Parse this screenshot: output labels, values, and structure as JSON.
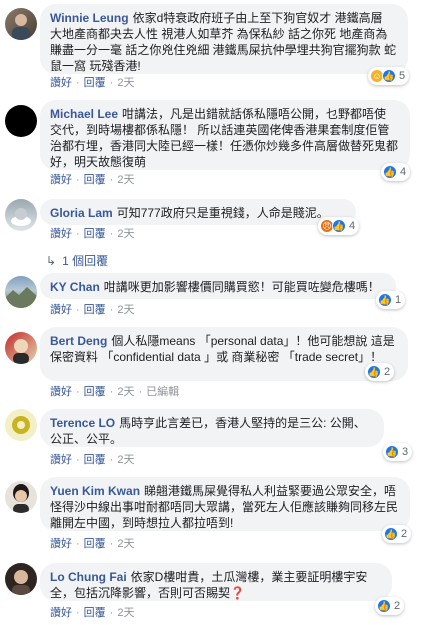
{
  "actions": {
    "like": "讚好",
    "reply": "回覆",
    "edited": "已編輯"
  },
  "comments": [
    {
      "author": "Winnie Leung",
      "text": "依家d特衰政府班子由上至下狗官奴才 港鐵高層 大地產商都夬去人性 視港人如草芥 為保私紗 話之你死 地產商為賺盡一分一毫 話之你兇住兇細 港鐵馬屎抗仲學埋共狗官擺狗款 蛇鼠一窩 玩殘香港!",
      "time": "2天",
      "reaction_count": "5"
    },
    {
      "author": "Michael Lee",
      "text": "咁講法，凡是出錯就話係私隱唔公開，乜野都唔使交代，到時場樓都係私隱！ 所以話連英國佬俾香港果套制度佢管治都冇埋，香港同大陸已經一樣！任憑你炒幾多件高層做替死鬼都好，明天故態復萌",
      "time": "2天",
      "reaction_count": "4"
    },
    {
      "author": "Gloria Lam",
      "text": "可知777政府只是重視錢，人命是賤泥。",
      "time": "2天",
      "reaction_count": "4"
    },
    {
      "author": "KY Chan",
      "text": "咁講咪更加影響樓價同購買慾！可能買咗變危樓嗎！",
      "time": "2天",
      "reaction_count": "1"
    },
    {
      "author": "Bert Deng",
      "text": "個人私隱means 「personal data」！他可能想說 這是保密資料 「confidential data 」或 商業秘密 「trade secret」！",
      "time": "2天",
      "reaction_count": "2"
    },
    {
      "author": "Terence LO",
      "text": "馬時亨此言差已，香港人堅持的是三公: 公開、公正、公平。",
      "time": "2天",
      "reaction_count": "3"
    },
    {
      "author": "Yuen Kim Kwan",
      "text": "睇翹港鐵馬屎覺得私人利益緊要過公眾安全，唔怪得沙中線出事咁耐都唔同大眾講，當死左人佢應該賺夠同移左民離開左中國，到時想拉人都拉唔到!",
      "time": "2天",
      "reaction_count": "2"
    },
    {
      "author": "Lo Chung Fai",
      "text": "依家D樓咁貴，土瓜灣樓，業主要証明樓宇安全，包括沉降影響，否則可否賜契",
      "time": "2天",
      "reaction_count": "2"
    }
  ],
  "replies_link": "1 個回覆",
  "question_mark": "❓"
}
